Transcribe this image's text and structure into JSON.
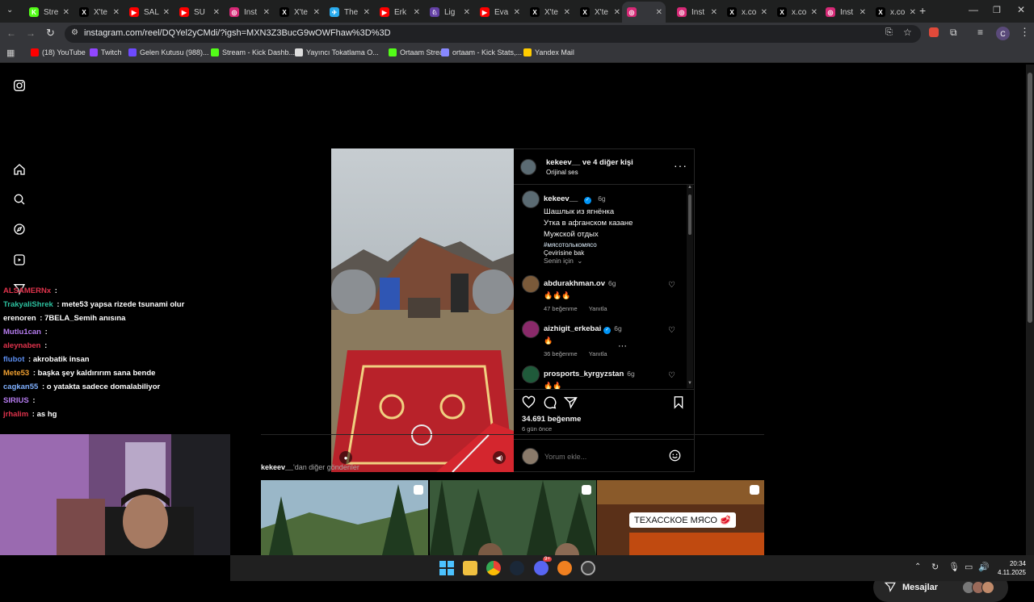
{
  "browser": {
    "tabs": [
      {
        "label": "Stre",
        "color": "#53fc18",
        "glyph": "K"
      },
      {
        "label": "X'te",
        "color": "#000000",
        "glyph": "X"
      },
      {
        "label": "SAL",
        "color": "#ff0000",
        "glyph": "▶"
      },
      {
        "label": "SU",
        "color": "#ff0000",
        "glyph": "▶"
      },
      {
        "label": "Inst",
        "color": "#d62976",
        "glyph": "◎"
      },
      {
        "label": "X'te",
        "color": "#000000",
        "glyph": "X"
      },
      {
        "label": "The",
        "color": "#2aabee",
        "glyph": "✈"
      },
      {
        "label": "Erk",
        "color": "#ff0000",
        "glyph": "▶"
      },
      {
        "label": "Lig",
        "color": "#6441a5",
        "glyph": "♘"
      },
      {
        "label": "Eva",
        "color": "#ff0000",
        "glyph": "▶"
      },
      {
        "label": "X'te",
        "color": "#000000",
        "glyph": "X"
      },
      {
        "label": "X'te",
        "color": "#000000",
        "glyph": "X"
      },
      {
        "label": "",
        "color": "#d62976",
        "glyph": "◎"
      },
      {
        "label": "Inst",
        "color": "#d62976",
        "glyph": "◎"
      },
      {
        "label": "x.co",
        "color": "#000000",
        "glyph": "X"
      },
      {
        "label": "x.co",
        "color": "#000000",
        "glyph": "X"
      },
      {
        "label": "Inst",
        "color": "#d62976",
        "glyph": "◎"
      },
      {
        "label": "x.co",
        "color": "#000000",
        "glyph": "X"
      }
    ],
    "url": "instagram.com/reel/DQYel2yCMdi/?igsh=MXN3Z3BucG9wOWFhaw%3D%3D",
    "bookmarks": [
      {
        "label": "(18) YouTube",
        "color": "#ff0000"
      },
      {
        "label": "Twitch",
        "color": "#9146ff"
      },
      {
        "label": "Gelen Kutusu (988)...",
        "color": "#6d4aff"
      },
      {
        "label": "Stream - Kick Dashb...",
        "color": "#53fc18"
      },
      {
        "label": "Yayıncı Tokatlama O...",
        "color": "#dddddd"
      },
      {
        "label": "Ortaam Stream",
        "color": "#53fc18"
      },
      {
        "label": "ortaam - Kick Stats,...",
        "color": "#8888ff"
      },
      {
        "label": "Yandex Mail",
        "color": "#ffcc00"
      }
    ],
    "profile_initial": "C"
  },
  "post": {
    "header_user": "kekeev__",
    "header_suffix": " ve 4 diğer kişi",
    "audio": "Orijinal ses",
    "caption_user": "kekeev__",
    "caption_time": "6g",
    "caption_lines": [
      "Шашлык из ягнёнка",
      "Утка в афганском  казане",
      "Мужской отдых"
    ],
    "hashtag": "#мясотолькомясо",
    "translate": "Çevirisine bak",
    "sort": "Senin için",
    "comments": [
      {
        "user": "abdurakhman.ov",
        "time": "6g",
        "text": "🔥🔥🔥",
        "likes": "47 beğenme",
        "reply": "Yanıtla",
        "verified": false,
        "color": "#7a5a3a"
      },
      {
        "user": "aizhigit_erkebai",
        "time": "6g",
        "text": "🔥",
        "likes": "36 beğenme",
        "reply": "Yanıtla",
        "verified": true,
        "color": "#8a2a6a"
      },
      {
        "user": "prosports_kyrgyzstan",
        "time": "6g",
        "text": "🔥🔥",
        "likes": "",
        "reply": "",
        "verified": false,
        "color": "#1f5a3a"
      }
    ],
    "like_count": "34.691 beğenme",
    "posted_ago": "6 gün önce",
    "comment_placeholder": "Yorum ekle..."
  },
  "more_posts": {
    "title_user": "kekeev__",
    "title_suffix": "'dan diğer gönderiler",
    "thumb3_text": "ТЕХАССКОЕ МЯСО 🥩"
  },
  "messages_label": "Mesajlar",
  "chat": [
    {
      "name": "ALSAMERNx",
      "name_color": "#e0334c",
      "text": ""
    },
    {
      "name": "TrakyaliShrek",
      "name_color": "#2dc2a0",
      "text": "mete53 yapsa rizede tsunami olur"
    },
    {
      "name": "erenoren",
      "name_color": "#ffffff",
      "text": "7BELA_Semih anısına"
    },
    {
      "name": "Mutlu1can",
      "name_color": "#b67cf0",
      "text": ""
    },
    {
      "name": "aleynaben",
      "name_color": "#e0334c",
      "text": ""
    },
    {
      "name": "flubot",
      "name_color": "#5b8def",
      "text": "akrobatik insan"
    },
    {
      "name": "Mete53",
      "name_color": "#f0a030",
      "text": "başka şey kaldırırım sana bende"
    },
    {
      "name": "cagkan55",
      "name_color": "#7fb0ff",
      "text": "o yatakta sadece domalabiliyor"
    },
    {
      "name": "SIRIUS",
      "name_color": "#b67cf0",
      "text": ""
    },
    {
      "name": "jrhalim",
      "name_color": "#e0334c",
      "text": "as hg"
    }
  ],
  "taskbar": {
    "time": "20:34",
    "date": "4.11.2025",
    "discord_badge": "9+"
  }
}
